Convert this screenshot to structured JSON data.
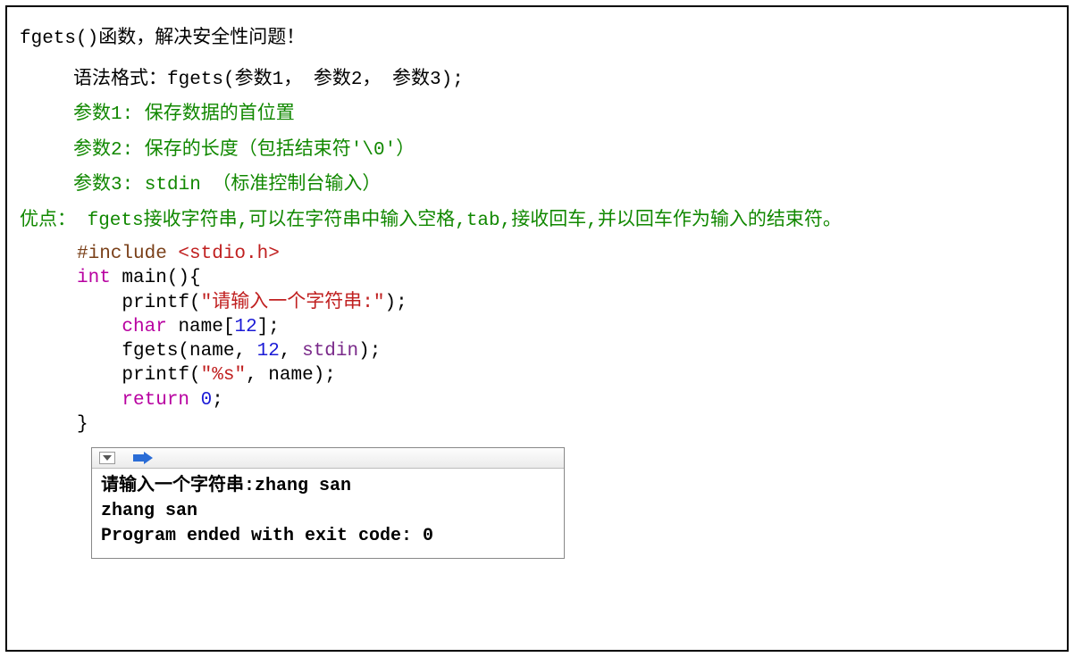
{
  "title": "fgets()函数，解决安全性问题！",
  "syntax_line": "语法格式：fgets(参数1， 参数2， 参数3);",
  "params": {
    "p1": "参数1:  保存数据的首位置",
    "p2": "参数2:  保存的长度（包括结束符'\\0'）",
    "p3": "参数3:  stdin （标准控制台输入）"
  },
  "advantage": "优点：  fgets接收字符串,可以在字符串中输入空格,tab,接收回车,并以回车作为输入的结束符。",
  "code": {
    "l1_pp": "#include ",
    "l1_inc": "<stdio.h>",
    "l2_kw": "int",
    "l2_fn": " main(){",
    "l3_fn": "printf",
    "l3_str": "\"请输入一个字符串:\"",
    "l3_end": ");",
    "l4_kw": "char",
    "l4_id": " name[",
    "l4_num": "12",
    "l4_end": "];",
    "l5_fn": "fgets(name, ",
    "l5_num": "12",
    "l5_mid": ", ",
    "l5_builtin": "stdin",
    "l5_end": ");",
    "l6_fn": "printf(",
    "l6_str": "\"%s\"",
    "l6_end": ", name);",
    "l7_kw": "return",
    "l7_sp": " ",
    "l7_num": "0",
    "l7_end": ";",
    "l8": "}"
  },
  "console": {
    "line1": "请输入一个字符串:zhang san",
    "line2": "zhang san",
    "line3": "Program ended with exit code: 0"
  }
}
